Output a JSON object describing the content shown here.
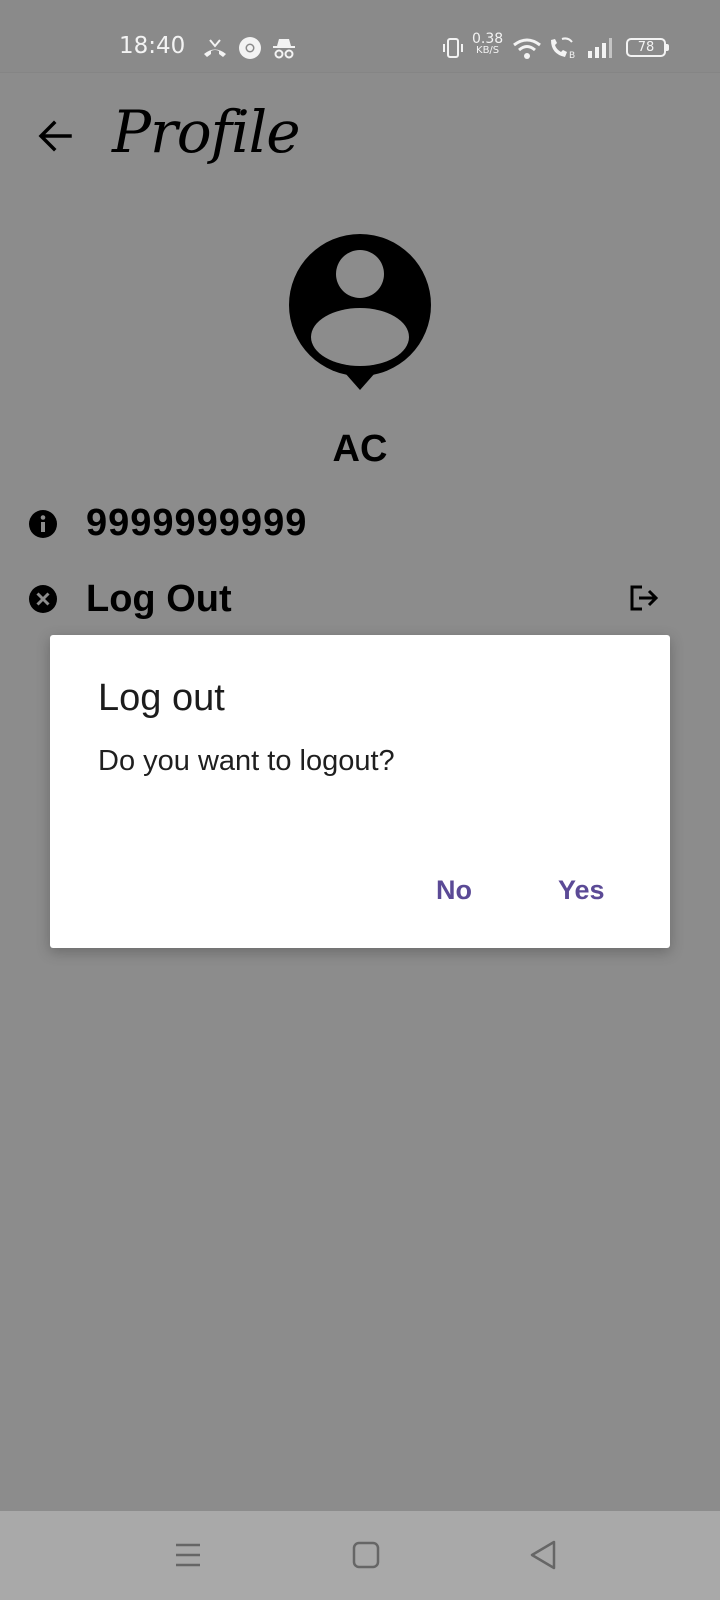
{
  "status_bar": {
    "time": "18:40",
    "net_speed_value": "0.38",
    "net_speed_unit": "KB/S",
    "battery": "78",
    "icons": [
      "missed-call-icon",
      "chrome-icon",
      "incognito-icon",
      "vibrate-icon",
      "wifi-icon",
      "wifi-calling-icon",
      "signal-icon",
      "battery-icon"
    ]
  },
  "header": {
    "title": "Profile",
    "back_icon": "arrow-left-icon"
  },
  "profile": {
    "name": "AC",
    "phone": "9999999999",
    "logout_label": "Log Out",
    "avatar_icon": "person-pin-icon",
    "phone_icon": "info-icon",
    "logout_row_icon": "cancel-icon",
    "logout_action_icon": "exit-icon"
  },
  "dialog": {
    "title": "Log out",
    "message": "Do you want to logout?",
    "no_label": "No",
    "yes_label": "Yes",
    "button_color": "#5b4a96"
  },
  "nav_bar": {
    "icons": [
      "menu-icon",
      "home-square-icon",
      "back-triangle-icon"
    ]
  }
}
